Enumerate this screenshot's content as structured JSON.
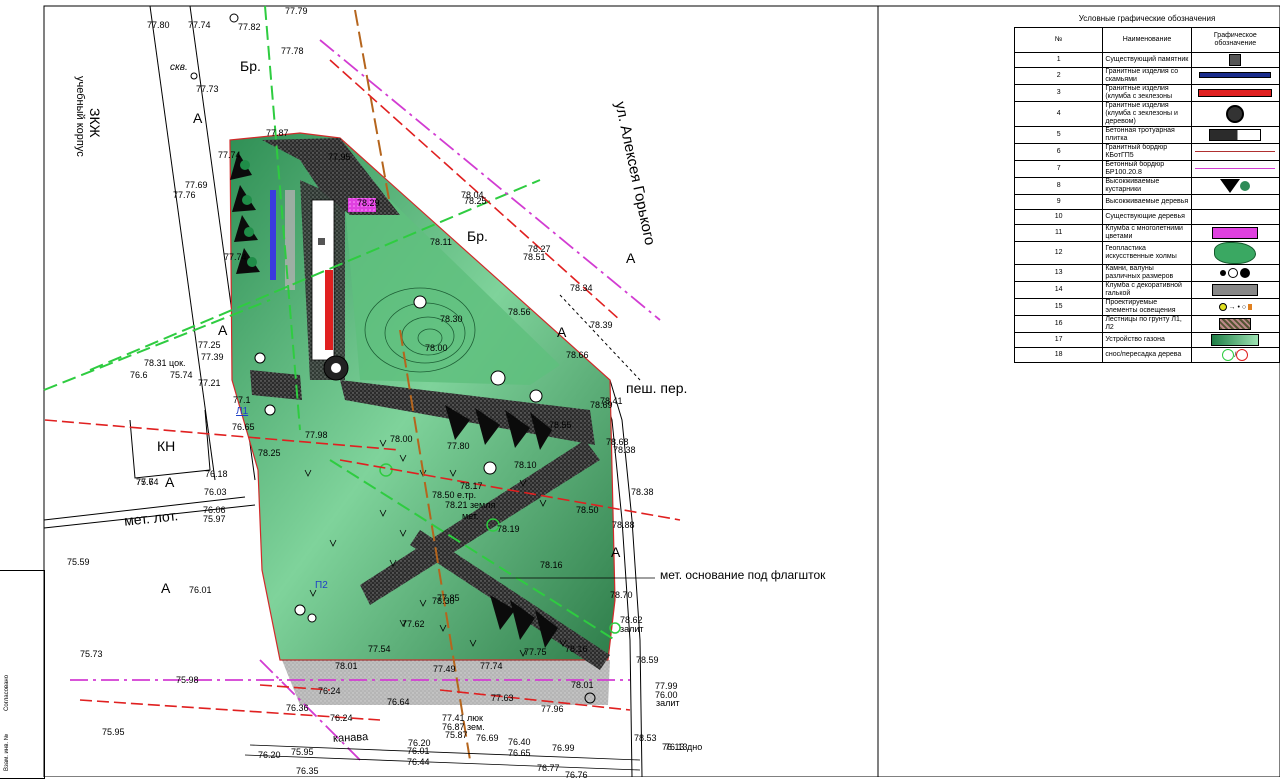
{
  "labels": {
    "street_main": "ул. Алексея Горького",
    "building": "ЗКЖ",
    "building_sub": "учебный корпус",
    "path_ped": "пеш. пер.",
    "path_met": "мет. лот.",
    "flagpole": "мет. основание под флагшток",
    "canal": "канава",
    "kn": "КН",
    "skv": "скв.",
    "br1": "Бр.",
    "br2": "Бр.",
    "a1": "А",
    "a2": "А",
    "a3": "А",
    "a4": "А",
    "a5": "А",
    "a6": "А",
    "a7": "А",
    "l1": "Л1",
    "l2": "П2",
    "zalit1": "залит",
    "zalit2": "залит",
    "dno": "76.13 дно",
    "elev_tr": "78.50 e.тр.",
    "zemlya": "78.21 земля",
    "met": "мет.",
    "lyuk": "77.41 люк",
    "zem": "76.87 зем.",
    "cok": "78.31 цок."
  },
  "elevations": [
    "77.82",
    "77.79",
    "77.78",
    "77.80",
    "77.74",
    "77.73",
    "77.87",
    "77.95",
    "77.74",
    "77.69",
    "77.76",
    "77.74",
    "77.39",
    "77.25",
    "77.21",
    "77.1",
    "76.65",
    "76.18",
    "76.03",
    "75.74",
    "76.06",
    "75.97",
    "75.59",
    "76.01",
    "75.73",
    "75.98",
    "75.95",
    "76.20",
    "75.95",
    "76.35",
    "76.24",
    "76.36",
    "76.24",
    "76.64",
    "76.20",
    "76.01",
    "76.44",
    "75.87",
    "76.69",
    "76.40",
    "76.65",
    "76.99",
    "76.77",
    "76.76",
    "78.53",
    "76.13",
    "77.99",
    "76.00",
    "77.96",
    "77.63",
    "77.49",
    "77.74",
    "78.01",
    "77.54",
    "78.01",
    "77.62",
    "77.85",
    "77.75",
    "78.16",
    "78.62",
    "78.59",
    "78.30",
    "78.50",
    "78.16",
    "78.55",
    "78.38",
    "78.88",
    "78.70",
    "78.38",
    "78.68",
    "78.41",
    "78.69",
    "78.66",
    "78.39",
    "78.34",
    "78.56",
    "78.51",
    "78.27",
    "78.25",
    "78.04",
    "78.29",
    "78.00",
    "77.80",
    "78.10",
    "78.17",
    "78.19",
    "78.00",
    "78.30",
    "78.11",
    "77.98",
    "78.25",
    "77.6",
    "76.6",
    "75.74"
  ],
  "legend": {
    "title": "Условные графические обозначения",
    "col_num": "№",
    "col_name": "Наименование",
    "col_sym": "Графическое обозначение",
    "rows": [
      {
        "num": "1",
        "name": "Существующий памятник",
        "sym": "monument-icon"
      },
      {
        "num": "2",
        "name": "Гранитные изделия со скамьями",
        "sym": "granite-bench-icon"
      },
      {
        "num": "3",
        "name": "Гранитные изделия (клумба с зеклезоны",
        "sym": "granite-flowerbed-icon"
      },
      {
        "num": "4",
        "name": "Гранитные изделия (клумба с зеклезоны и деревом)",
        "sym": "granite-tree-icon"
      },
      {
        "num": "5",
        "name": "Бетонная тротуарная плитка",
        "sym": "paving-icon"
      },
      {
        "num": "6",
        "name": "Гранитный бордюр КБотГП5",
        "sym": "granite-curb-icon"
      },
      {
        "num": "7",
        "name": "Бетонный бордюр БР100.20.8",
        "sym": "concrete-curb-icon"
      },
      {
        "num": "8",
        "name": "Высокживаемые кустарники",
        "sym": "shrub-icon"
      },
      {
        "num": "9",
        "name": "Высокживаемые деревья",
        "sym": "tree-icon"
      },
      {
        "num": "10",
        "name": "Существующие деревья",
        "sym": "existing-tree-icon"
      },
      {
        "num": "11",
        "name": "Клумба с многолетними цветами",
        "sym": "flowerbed-icon"
      },
      {
        "num": "12",
        "name": "Геопластика искусственные холмы",
        "sym": "geoplastic-icon"
      },
      {
        "num": "13",
        "name": "Камни, валуны различных размеров",
        "sym": "boulder-icon"
      },
      {
        "num": "14",
        "name": "Клумба с декоративной галькой",
        "sym": "pebble-bed-icon"
      },
      {
        "num": "15",
        "name": "Проектируемые элементы освещения",
        "sym": "lighting-icon"
      },
      {
        "num": "16",
        "name": "Лестницы по грунту Л1, Л2",
        "sym": "stairs-icon"
      },
      {
        "num": "17",
        "name": "Устройство газона",
        "sym": "lawn-icon"
      },
      {
        "num": "18",
        "name": "снос/пересадка дерева",
        "sym": "tree-removal-icon"
      }
    ]
  },
  "stamp": {
    "line1": "Согласовано",
    "line2": "Взам. инв. №"
  },
  "colors": {
    "lawn": "#4caf6e",
    "paving": "#3a3a3a",
    "green_line": "#2ecc40",
    "magenta_line": "#d23cd2",
    "red_arrow": "#e02020",
    "brown_line": "#b5651d",
    "flower": "#e040e0"
  }
}
